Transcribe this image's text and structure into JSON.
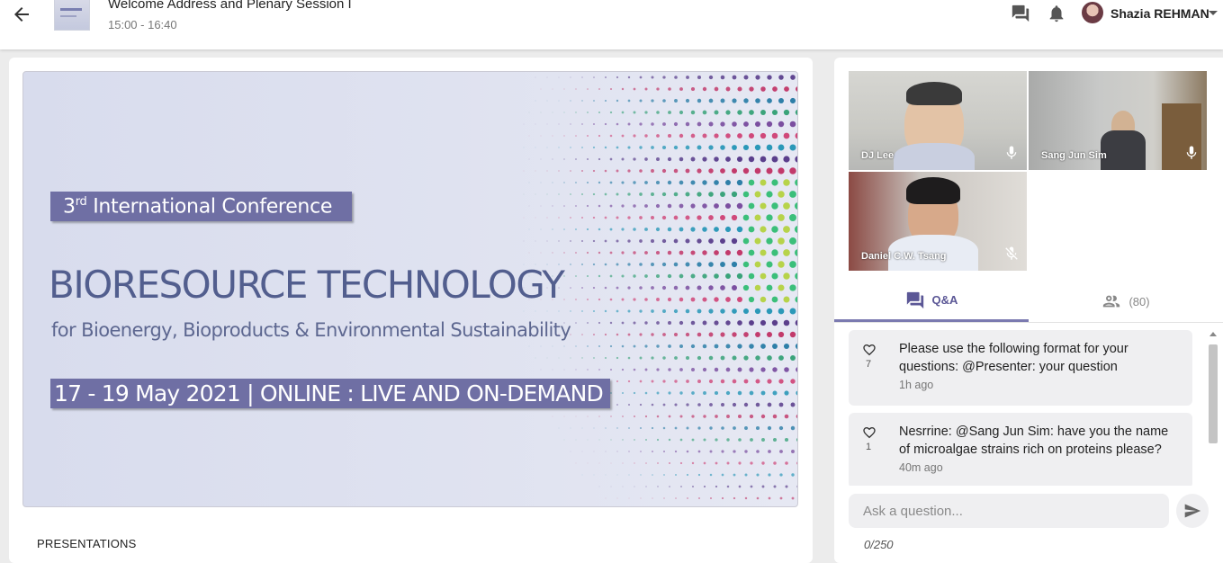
{
  "header": {
    "back_icon": "arrow-left-icon",
    "session_title": "Welcome Address and Plenary Session I",
    "session_time": "15:00 - 16:40",
    "chat_icon": "chat-bubbles-icon",
    "notification_icon": "bell-icon",
    "user_name": "Shazia REHMAN",
    "menu_icon": "caret-down-icon"
  },
  "banner": {
    "conference_ordinal": "3",
    "conference_ordinal_suffix": "rd",
    "conference_name": "International Conference",
    "title": "BIORESOURCE TECHNOLOGY",
    "subtitle": "for Bioenergy, Bioproducts & Environmental Sustainability",
    "dates": "17 - 19 May 2021 | ONLINE : LIVE AND ON-DEMAND",
    "brand_color": "#6f6fa4",
    "title_color": "#525e8e"
  },
  "main": {
    "section_label": "PRESENTATIONS"
  },
  "videos": [
    {
      "name": "DJ Lee",
      "mic": "mic-on-icon"
    },
    {
      "name": "Sang Jun Sim",
      "mic": "mic-on-icon"
    },
    {
      "name": "Daniel C.W. Tsang",
      "mic": "mic-off-icon"
    }
  ],
  "tabs": {
    "qa_label": "Q&A",
    "people_count": "(80)",
    "active_color": "#5b5796"
  },
  "qa": [
    {
      "likes": "7",
      "text": "Please use the following format for your questions: @Presenter: your question",
      "time": "1h ago"
    },
    {
      "likes": "1",
      "text": "Nesrrine: @Sang Jun Sim: have you the name of microalgae strains rich on proteins please?",
      "time": "40m ago"
    }
  ],
  "ask": {
    "placeholder": "Ask a question...",
    "char_count": "0/250",
    "send_icon": "send-icon"
  }
}
